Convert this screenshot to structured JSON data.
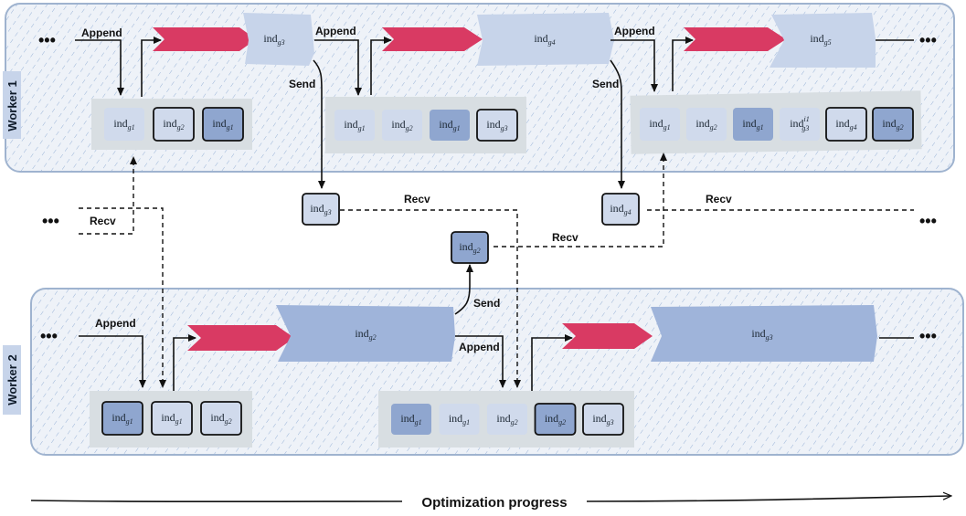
{
  "workers": [
    {
      "label": "Worker 1"
    },
    {
      "label": "Worker 2"
    }
  ],
  "labels": {
    "append": "Append",
    "send": "Send",
    "recv": "Recv",
    "dots": "•••",
    "progress": "Optimization progress"
  },
  "individual_base": "ind",
  "stages": [
    {
      "sub": "g3"
    },
    {
      "sub": "g4"
    },
    {
      "sub": "g5"
    },
    {
      "sub": "g2"
    },
    {
      "sub": "g3"
    }
  ],
  "pools": [
    {
      "worker": 1,
      "items": [
        {
          "sub": "g1",
          "style": "light"
        },
        {
          "sub": "g2",
          "style": "outlined"
        },
        {
          "sub": "g1",
          "style": "dark-outlined"
        }
      ]
    },
    {
      "worker": 1,
      "items": [
        {
          "sub": "g1",
          "style": "light"
        },
        {
          "sub": "g2",
          "style": "light"
        },
        {
          "sub": "g1",
          "style": "dark"
        },
        {
          "sub": "g3",
          "style": "outlined"
        }
      ]
    },
    {
      "worker": 1,
      "items": [
        {
          "sub": "g1",
          "style": "light"
        },
        {
          "sub": "g2",
          "style": "light"
        },
        {
          "sub": "g1",
          "style": "dark"
        },
        {
          "sub": "g3",
          "sup": "i1",
          "style": "light"
        },
        {
          "sub": "g4",
          "style": "outlined"
        },
        {
          "sub": "g2",
          "style": "dark-outlined"
        }
      ]
    },
    {
      "worker": 2,
      "items": [
        {
          "sub": "g1",
          "style": "dark-outlined"
        },
        {
          "sub": "g1",
          "style": "outlined"
        },
        {
          "sub": "g2",
          "style": "outlined"
        }
      ]
    },
    {
      "worker": 2,
      "items": [
        {
          "sub": "g1",
          "style": "dark"
        },
        {
          "sub": "g1",
          "style": "light"
        },
        {
          "sub": "g2",
          "style": "light"
        },
        {
          "sub": "g2",
          "style": "dark-outlined"
        },
        {
          "sub": "g3",
          "style": "outlined"
        }
      ]
    }
  ],
  "messages": [
    {
      "sub": "g3",
      "style": "outlined"
    },
    {
      "sub": "g4",
      "style": "outlined"
    },
    {
      "sub": "g2",
      "style": "dark-outlined"
    }
  ],
  "colors": {
    "background_band": "#e8eef6",
    "band_border": "#9fb3cf",
    "hatch": "#9ab4d8",
    "pool_bg": "#d8dee2",
    "item_light": "#d0daec",
    "item_dark": "#8fa6cf",
    "stage_light": "#c7d4ea",
    "stage_dark": "#9fb4da",
    "arrow_red": "#d93a63",
    "worker_tag": "#c7d4ea"
  }
}
